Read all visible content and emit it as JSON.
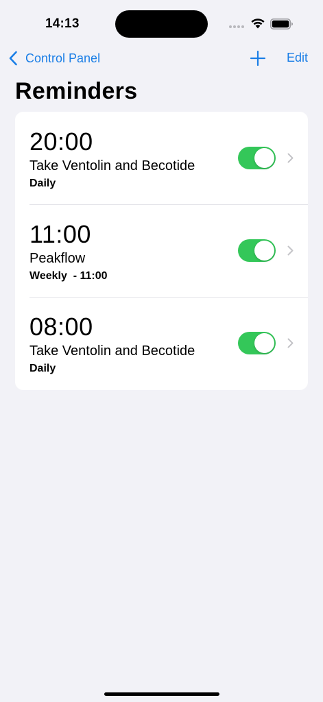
{
  "status_bar": {
    "time": "14:13"
  },
  "nav": {
    "back_label": "Control Panel",
    "edit_label": "Edit"
  },
  "page": {
    "title": "Reminders"
  },
  "reminders": [
    {
      "time": "20:00",
      "title": "Take Ventolin and Becotide",
      "frequency": "Daily",
      "enabled": true
    },
    {
      "time": "11:00",
      "title": "Peakflow",
      "frequency": "Weekly  - 11:00",
      "enabled": true
    },
    {
      "time": "08:00",
      "title": "Take Ventolin and Becotide",
      "frequency": "Daily",
      "enabled": true
    }
  ],
  "colors": {
    "accent": "#1a7ee6",
    "toggle_on": "#34c759",
    "background": "#f2f2f7"
  },
  "icons": [
    "chevron-left-icon",
    "plus-icon",
    "chevron-right-icon",
    "wifi-icon",
    "battery-icon"
  ]
}
